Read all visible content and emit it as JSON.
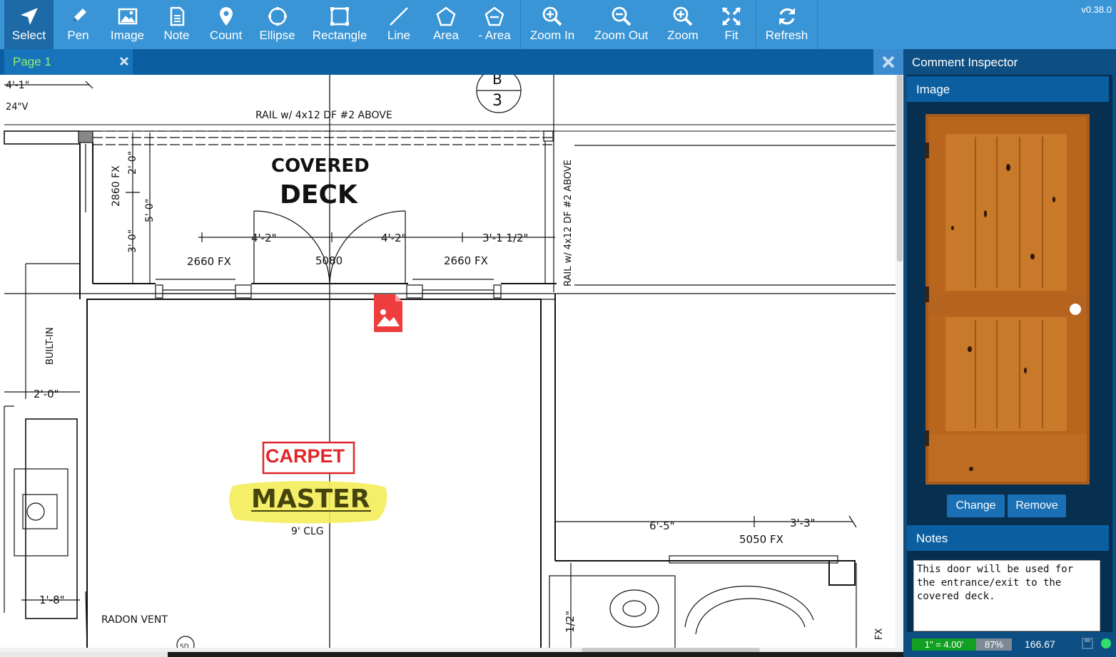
{
  "app": {
    "version": "v0.38.0"
  },
  "toolbar": {
    "tools": [
      {
        "label": "Select"
      },
      {
        "label": "Pen"
      },
      {
        "label": "Image"
      },
      {
        "label": "Note"
      },
      {
        "label": "Count"
      },
      {
        "label": "Ellipse"
      },
      {
        "label": "Rectangle"
      },
      {
        "label": "Line"
      },
      {
        "label": "Area"
      },
      {
        "label": "- Area"
      },
      {
        "label": "Zoom In"
      },
      {
        "label": "Zoom Out"
      },
      {
        "label": "Zoom"
      },
      {
        "label": "Fit"
      },
      {
        "label": "Refresh"
      }
    ],
    "active_tool": "Select"
  },
  "tabs": [
    {
      "label": "Page 1"
    }
  ],
  "plan": {
    "dims": [
      "4'-1\"",
      "24\"V",
      "4'-2\"",
      "4'-2\"",
      "3'-1 1/2\"",
      "2'-0\"",
      "5'-0\"",
      "3'-0\"",
      "2'-0\"",
      "1'-8\"",
      "6'-5\"",
      "3'-3\"",
      "1/2\""
    ],
    "labels": [
      "RAIL w/ 4x12 DF #2 ABOVE",
      "COVERED",
      "DECK",
      "2860 FX",
      "2660 FX",
      "5080",
      "2660 FX",
      "RAIL w/ 4x12 DF #2 ABOVE",
      "BUILT-IN",
      "9' CLG",
      "5050 FX",
      "RADON VENT",
      "FX",
      "SD",
      "B",
      "3"
    ],
    "room_label": "MASTER",
    "stamp_label": "CARPET"
  },
  "inspector": {
    "title": "Comment Inspector",
    "image_section": "Image",
    "change_label": "Change",
    "remove_label": "Remove",
    "notes_section": "Notes",
    "notes_text": "This door will be used for the entrance/exit to the covered deck."
  },
  "status": {
    "scale": "1\" = 4.00'",
    "zoom": "87%",
    "coord": "166.67"
  },
  "colors": {
    "toolbar": "#3a95d6",
    "tabbar": "#0b5fa0",
    "panel": "#062f50",
    "stamp": "#e0262a",
    "highlight": "#f4ec58",
    "status_ok": "#2ee06a"
  }
}
